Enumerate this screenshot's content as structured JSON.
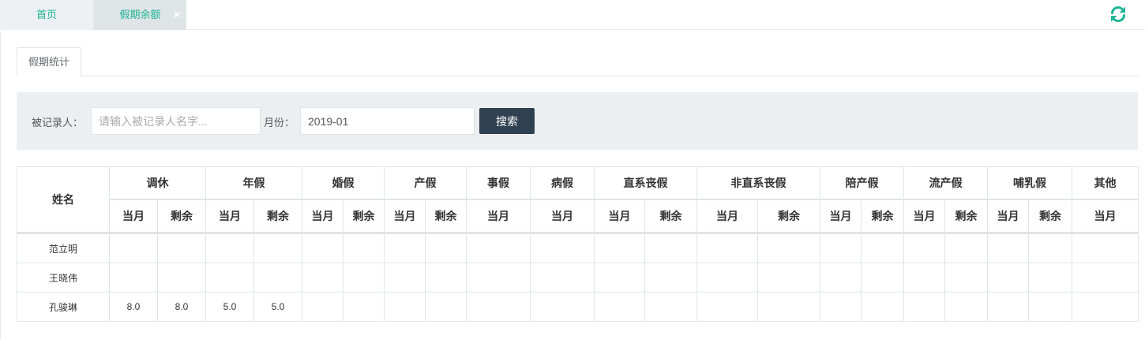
{
  "tabs": {
    "home": "首页",
    "active": "假期余额",
    "close": "×"
  },
  "inner_tab": "假期统计",
  "search": {
    "person_label": "被记录人：",
    "person_placeholder": "请输入被记录人名字...",
    "person_value": "",
    "month_label": "月份：",
    "month_value": "2019-01",
    "button": "搜索"
  },
  "table": {
    "name_header": "姓名",
    "groups": [
      "调休",
      "年假",
      "婚假",
      "产假",
      "事假",
      "病假",
      "直系丧假",
      "非直系丧假",
      "陪产假",
      "流产假",
      "哺乳假",
      "其他"
    ],
    "sub_current": "当月",
    "sub_remaining": "剩余",
    "rows": [
      {
        "name": "范立明",
        "cells": [
          "",
          "",
          "",
          "",
          "",
          "",
          "",
          "",
          "",
          "",
          "",
          "",
          "",
          "",
          "",
          "",
          "",
          "",
          "",
          "",
          ""
        ]
      },
      {
        "name": "王晓伟",
        "cells": [
          "",
          "",
          "",
          "",
          "",
          "",
          "",
          "",
          "",
          "",
          "",
          "",
          "",
          "",
          "",
          "",
          "",
          "",
          "",
          "",
          ""
        ]
      },
      {
        "name": "孔骏琳",
        "cells": [
          "8.0",
          "8.0",
          "5.0",
          "5.0",
          "",
          "",
          "",
          "",
          "",
          "",
          "",
          "",
          "",
          "",
          "",
          "",
          "",
          "",
          "",
          "",
          ""
        ]
      }
    ]
  },
  "colors": {
    "accent": "#1ab394",
    "button": "#2f4050",
    "panel": "#eceff1"
  },
  "icons": {
    "refresh": "refresh-icon"
  }
}
